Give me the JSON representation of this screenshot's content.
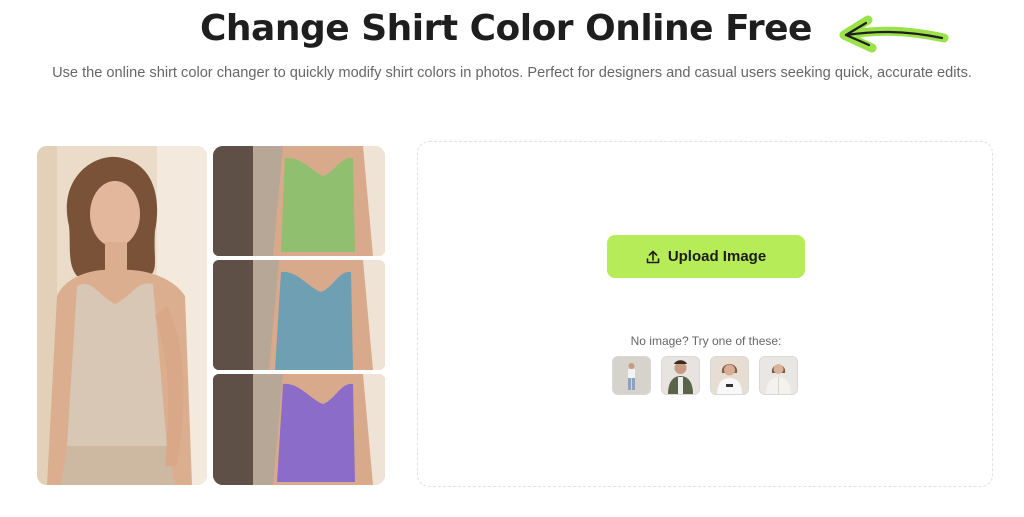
{
  "header": {
    "title": "Change Shirt Color Online Free",
    "subtitle": "Use the online shirt color changer to quickly modify shirt colors in photos. Perfect for designers and casual users seeking quick, accurate edits.",
    "arrow_color": "#9be24a"
  },
  "collage": {
    "main_shirt_color": "#d8c7b4",
    "variant_colors": [
      "#8fbf6f",
      "#6f9fb3",
      "#8b6cc9"
    ]
  },
  "upload": {
    "button_label": "Upload Image",
    "button_icon": "upload-icon",
    "button_color": "#b7ec59",
    "hint": "No image? Try one of these:",
    "samples": [
      {
        "name": "sample-woman-white-top"
      },
      {
        "name": "sample-man-green-vest"
      },
      {
        "name": "sample-woman-white-tee"
      },
      {
        "name": "sample-woman-white-shirt"
      }
    ]
  }
}
